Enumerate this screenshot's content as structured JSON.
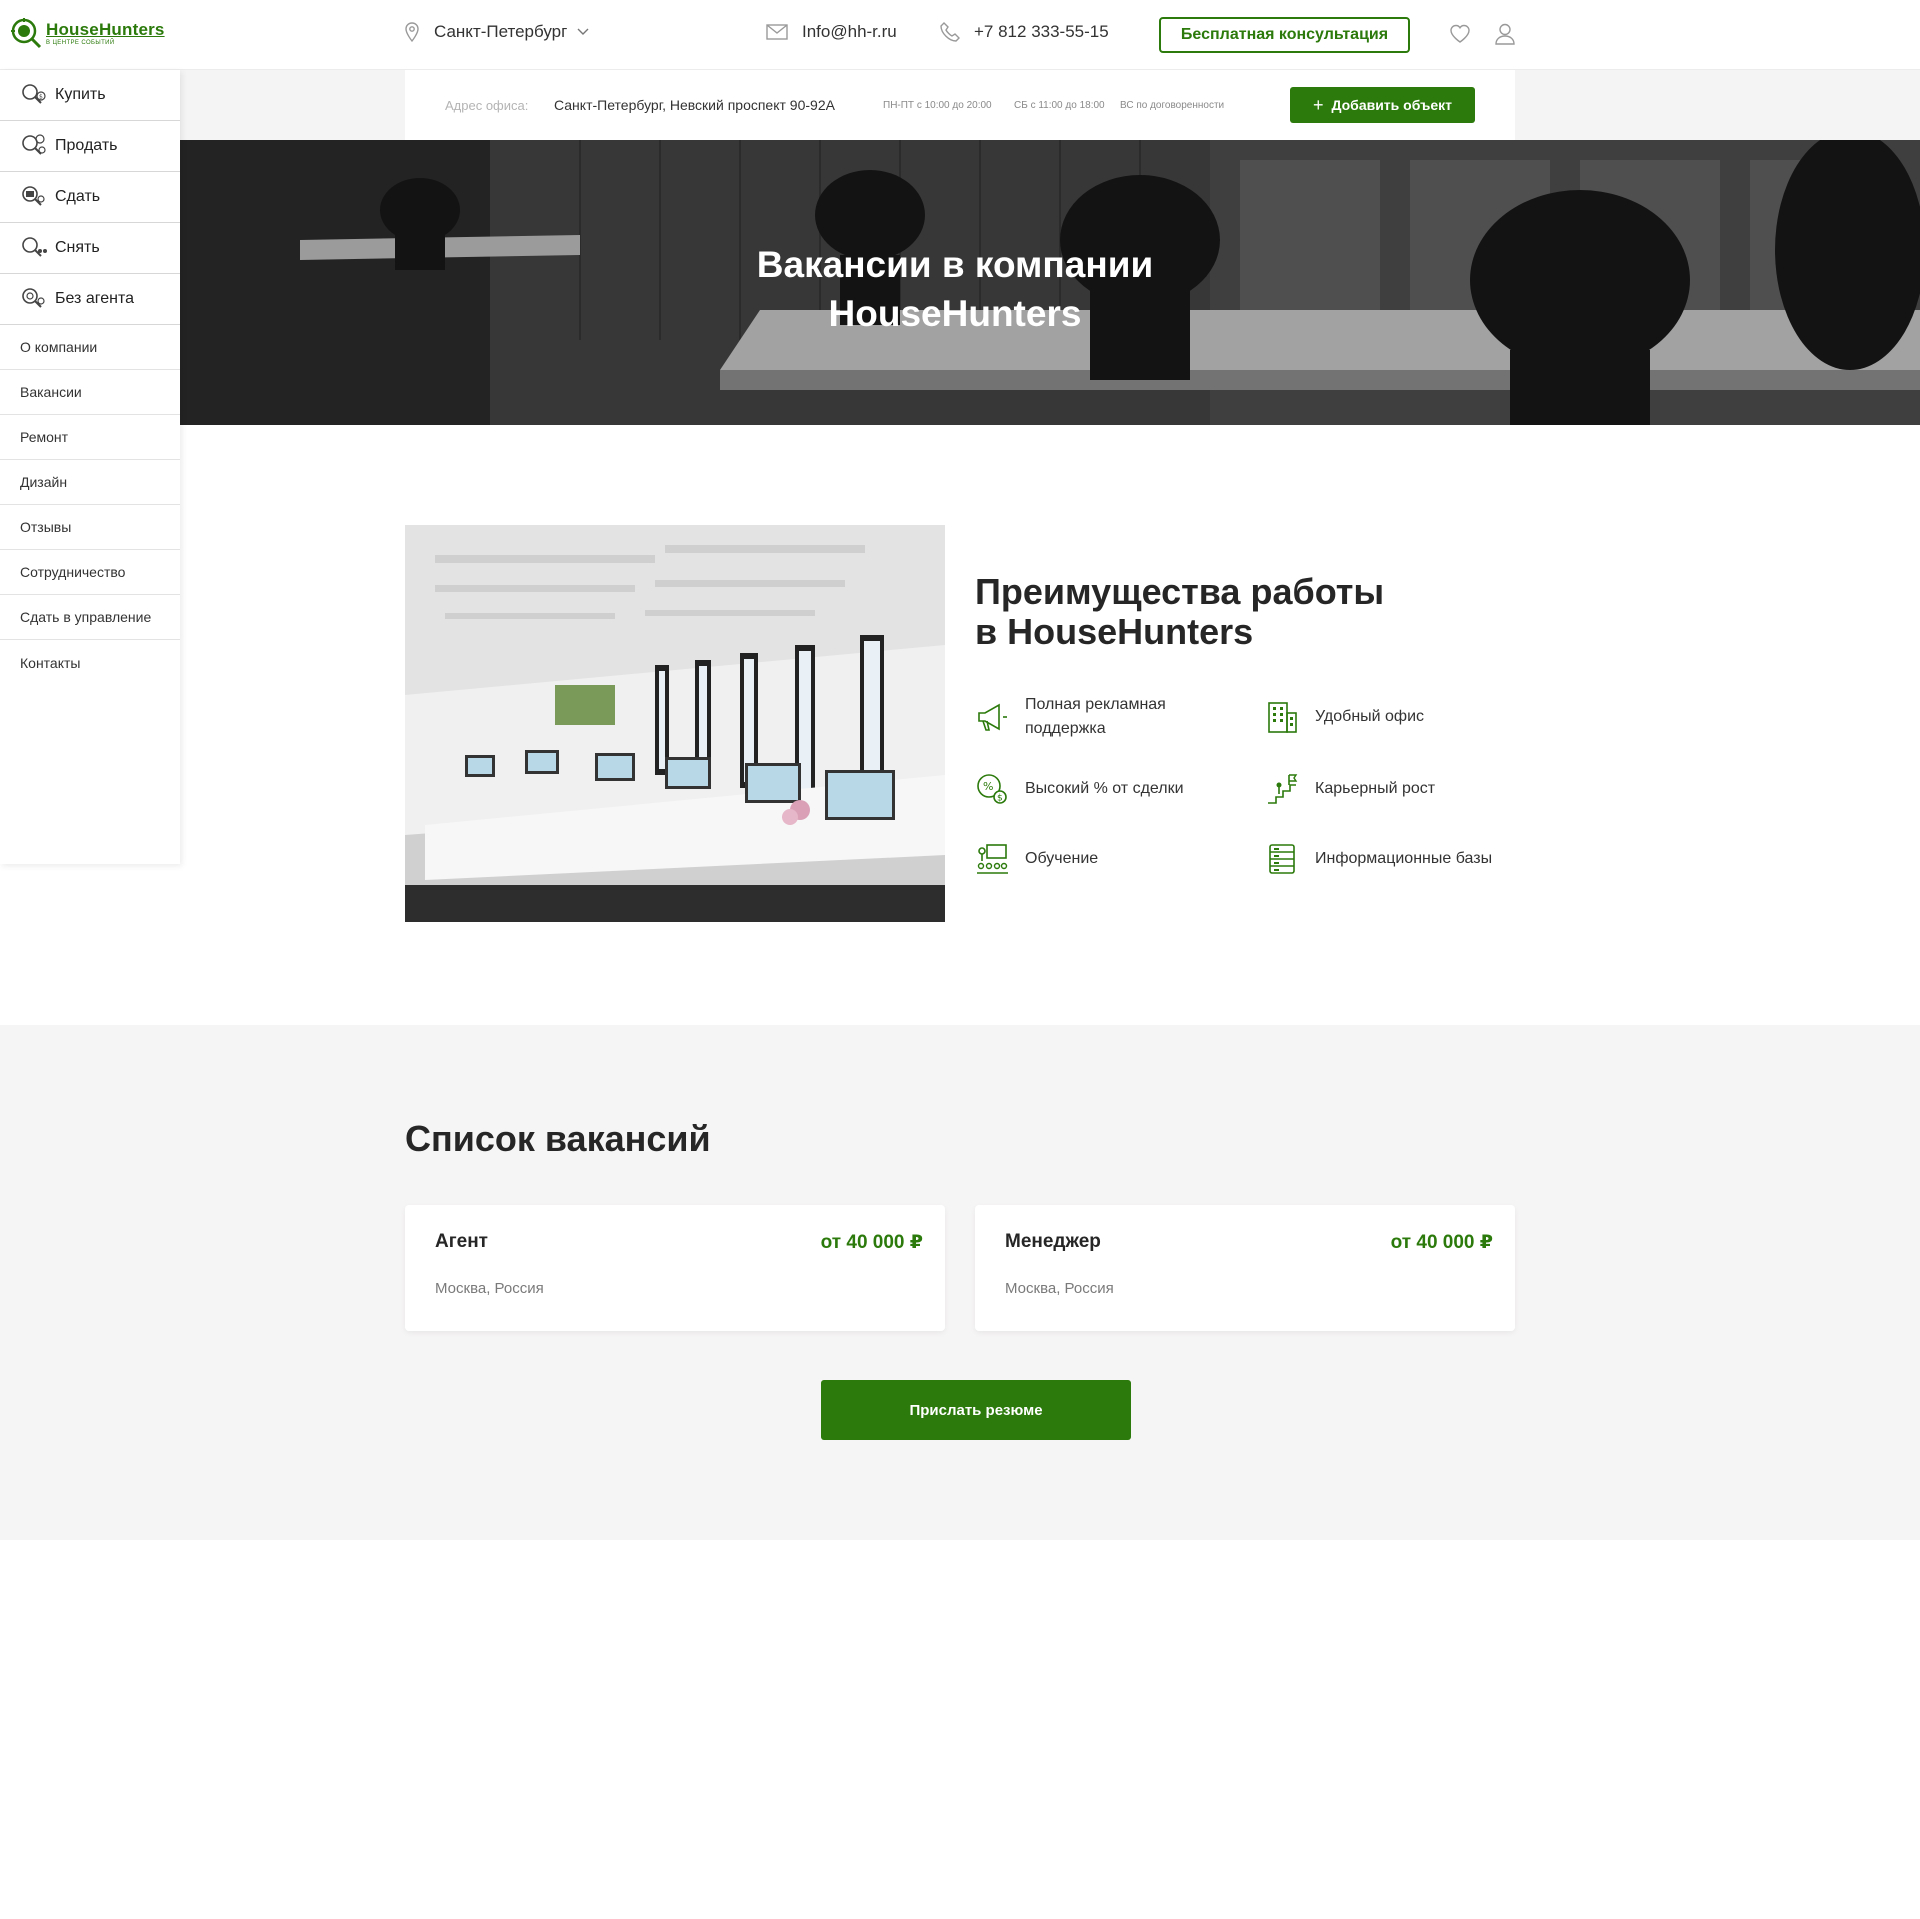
{
  "brand": {
    "name": "HouseHunters",
    "tagline": "В ЦЕНТРЕ СОБЫТИЙ",
    "accent": "#2b7a0b"
  },
  "header": {
    "city": "Санкт-Петербург",
    "email": "Info@hh-r.ru",
    "phone": "+7 812 333-55-15",
    "consult_label": "Бесплатная консультация"
  },
  "subbar": {
    "address_label": "Адрес офиса:",
    "address": "Санкт-Петербург, Невский проспект 90-92А",
    "hours_weekdays": "ПН-ПТ с 10:00 до 20:00",
    "hours_saturday": "СБ с 11:00 до 18:00",
    "hours_sunday": "ВС по договоренности",
    "add_label": "Добавить объект"
  },
  "sidebar": {
    "main": [
      {
        "label": "Купить",
        "icon": "search-buy-icon"
      },
      {
        "label": "Продать",
        "icon": "search-sell-icon"
      },
      {
        "label": "Сдать",
        "icon": "search-rent-out-icon"
      },
      {
        "label": "Снять",
        "icon": "search-rent-icon"
      },
      {
        "label": "Без агента",
        "icon": "search-no-agent-icon"
      }
    ],
    "links": [
      "О компании",
      "Вакансии",
      "Ремонт",
      "Дизайн",
      "Отзывы",
      "Сотрудничество",
      "Сдать в управление",
      "Контакты"
    ]
  },
  "hero": {
    "title_line1": "Вакансии в компании",
    "title_line2": "HouseHunters"
  },
  "advantages": {
    "title_line1": "Преимущества работы",
    "title_line2": "в HouseHunters",
    "items": [
      {
        "label": "Полная рекламная поддержка",
        "icon": "megaphone-icon"
      },
      {
        "label": "Удобный офис",
        "icon": "building-icon"
      },
      {
        "label": "Высокий % от сделки",
        "icon": "percent-money-icon"
      },
      {
        "label": "Карьерный рост",
        "icon": "career-stairs-icon"
      },
      {
        "label": "Обучение",
        "icon": "training-icon"
      },
      {
        "label": "Информационные базы",
        "icon": "database-icon"
      }
    ]
  },
  "vacancies": {
    "title": "Список вакансий",
    "items": [
      {
        "name": "Агент",
        "salary": "от 40 000 ₽",
        "location": "Москва, Россия"
      },
      {
        "name": "Менеджер",
        "salary": "от 40 000 ₽",
        "location": "Москва, Россия"
      }
    ],
    "resume_label": "Прислать резюме"
  }
}
